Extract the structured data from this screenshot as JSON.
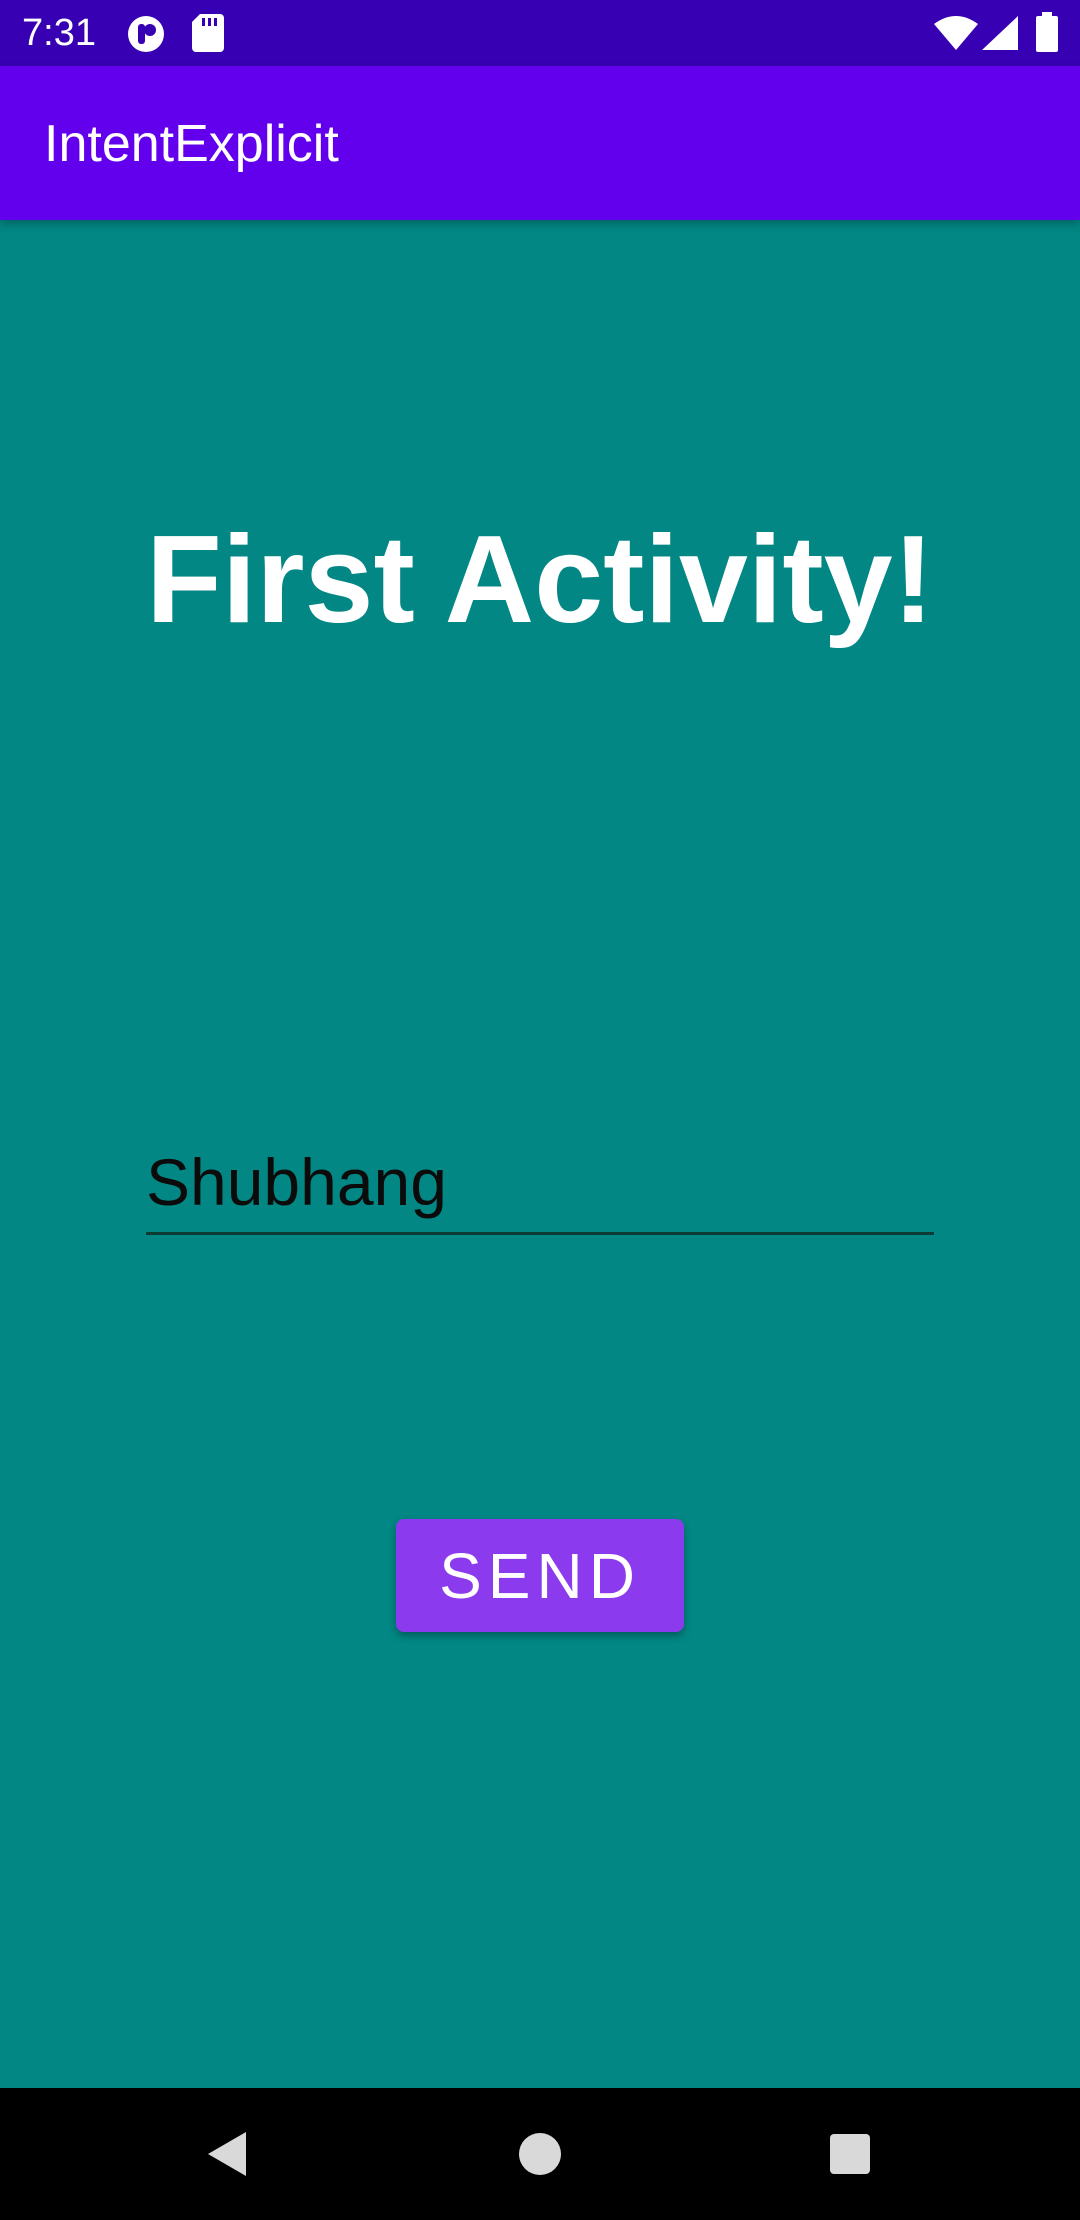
{
  "status_bar": {
    "time": "7:31",
    "background": "#3700b3",
    "icons": [
      "app-notification-icon",
      "sd-card-icon",
      "wifi-icon",
      "cell-signal-icon",
      "battery-icon"
    ]
  },
  "app_bar": {
    "title": "IntentExplicit",
    "background": "#6200ee"
  },
  "main": {
    "background": "#028784",
    "headline": "First Activity!",
    "name_field": {
      "value": "Shubhang"
    },
    "send_button": {
      "label": "SEND",
      "background": "#8c3aee"
    }
  },
  "nav_bar": {
    "buttons": [
      "back-icon",
      "home-icon",
      "recents-icon"
    ]
  }
}
